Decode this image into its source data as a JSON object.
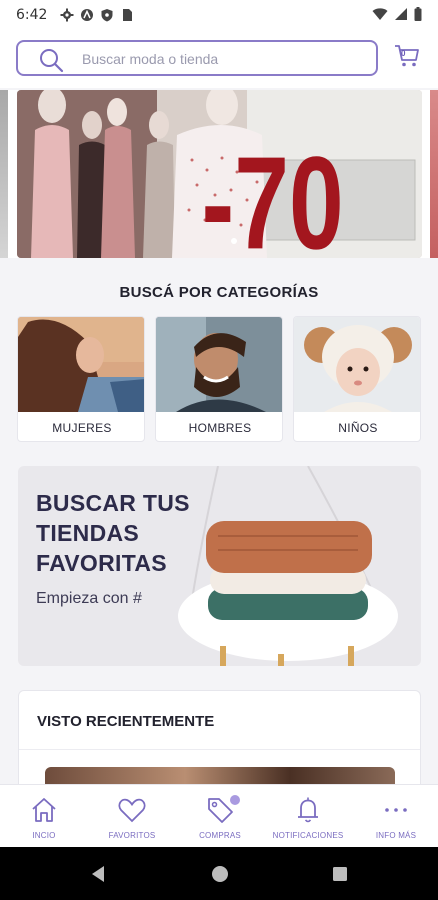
{
  "status_bar": {
    "time": "6:42"
  },
  "search": {
    "placeholder": "Buscar moda o tienda"
  },
  "cart": {
    "count": "0"
  },
  "banner": {
    "text": "-70"
  },
  "categories": {
    "title": "BUSCÁ POR CATEGORÍAS",
    "items": [
      {
        "label": "MUJERES"
      },
      {
        "label": "HOMBRES"
      },
      {
        "label": "NIÑOS"
      }
    ]
  },
  "promo": {
    "line1": "BUSCAR TUS",
    "line2": "TIENDAS",
    "line3": "FAVORITAS",
    "subtitle": "Empieza con #"
  },
  "recent": {
    "title": "VISTO RECIENTEMENTE"
  },
  "bottom_nav": {
    "items": [
      {
        "label": "INCIO",
        "icon": "home-icon"
      },
      {
        "label": "FAVORITOS",
        "icon": "heart-icon"
      },
      {
        "label": "COMPRAS",
        "icon": "tag-icon"
      },
      {
        "label": "NOTIFICACIONES",
        "icon": "bell-icon"
      },
      {
        "label": "INFO MÁS",
        "icon": "more-icon"
      }
    ]
  },
  "colors": {
    "accent": "#7a6cc0",
    "banner_number": "#a3161e"
  }
}
